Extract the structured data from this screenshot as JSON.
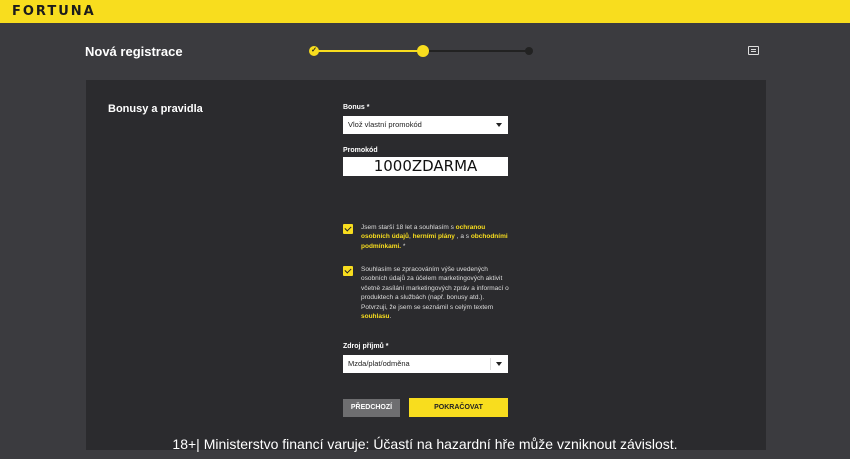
{
  "header": {
    "logo": "FORTUNA"
  },
  "registration": {
    "title": "Nová registrace",
    "progress": {
      "total_steps": 3,
      "completed_steps": 1,
      "current_step": 2,
      "step1_mark": "✓"
    }
  },
  "section": {
    "title": "Bonusy a pravidla"
  },
  "bonus": {
    "label": "Bonus *",
    "selected": "Vlož vlastní promokód"
  },
  "promo": {
    "label": "Promokód",
    "value": "1000ZDARMA"
  },
  "consent1": {
    "checked": true,
    "t1": "Jsem starší 18 let a souhlasím s ",
    "l1": "ochranou osobních údajů",
    "t2": ", ",
    "l2": "herními plány",
    "t3": " , a s ",
    "l3": "obchodními podmínkami.",
    "t4": " *"
  },
  "consent2": {
    "checked": true,
    "t1": "Souhlasím se zpracováním výše uvedených osobních údajů za účelem marketingových aktivit včetně zasílání marketingových zpráv a informací o produktech a službách (např. bonusy atd.).",
    "t2": "Potvrzuji, že jsem se seznámil s celým textem ",
    "l1": "souhlasu",
    "t3": "."
  },
  "income": {
    "label": "Zdroj příjmů *",
    "selected": "Mzda/plat/odměna"
  },
  "buttons": {
    "prev": "PŘEDCHOZÍ",
    "next": "POKRAČOVAT"
  },
  "footer": {
    "warning": "18+| Ministerstvo financí varuje: Účastí na hazardní hře může vzniknout závislost."
  },
  "colors": {
    "accent": "#f8dd1e",
    "background": "#3b3b3f",
    "card": "#2b2b2e"
  },
  "icons": {
    "chat": "chat-icon",
    "dropdown": "chevron-down-icon",
    "check": "check-icon"
  }
}
